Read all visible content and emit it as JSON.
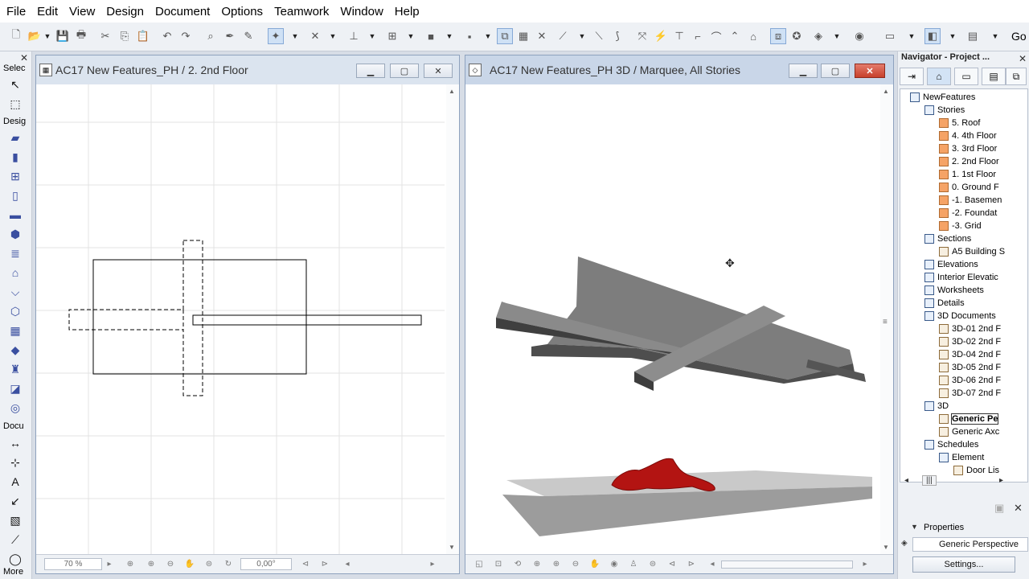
{
  "menu": [
    "File",
    "Edit",
    "View",
    "Design",
    "Document",
    "Options",
    "Teamwork",
    "Window",
    "Help"
  ],
  "toolbar": {
    "go_label": "Go"
  },
  "toolbox": {
    "select_label": "Selec",
    "design_label": "Desig",
    "document_label": "Docu",
    "more_label": "More"
  },
  "plan_window": {
    "title": "AC17 New Features_PH / 2. 2nd Floor",
    "zoom": "70 %",
    "angle": "0,00°"
  },
  "view3d_window": {
    "title": "AC17 New Features_PH 3D / Marquee, All Stories"
  },
  "navigator": {
    "title": "Navigator - Project ...",
    "tree": [
      {
        "label": "NewFeatures",
        "level": 0,
        "kind": "folder"
      },
      {
        "label": "Stories",
        "level": 1,
        "kind": "folder"
      },
      {
        "label": "5. Roof",
        "level": 2,
        "kind": "story"
      },
      {
        "label": "4. 4th Floor",
        "level": 2,
        "kind": "story"
      },
      {
        "label": "3. 3rd Floor",
        "level": 2,
        "kind": "story"
      },
      {
        "label": "2. 2nd Floor",
        "level": 2,
        "kind": "story"
      },
      {
        "label": "1. 1st Floor",
        "level": 2,
        "kind": "story"
      },
      {
        "label": "0. Ground F",
        "level": 2,
        "kind": "story"
      },
      {
        "label": "-1. Basemen",
        "level": 2,
        "kind": "story"
      },
      {
        "label": "-2. Foundat",
        "level": 2,
        "kind": "story"
      },
      {
        "label": "-3. Grid",
        "level": 2,
        "kind": "story"
      },
      {
        "label": "Sections",
        "level": 1,
        "kind": "folder"
      },
      {
        "label": "A5 Building S",
        "level": 2,
        "kind": "doc"
      },
      {
        "label": "Elevations",
        "level": 1,
        "kind": "folder"
      },
      {
        "label": "Interior Elevatic",
        "level": 1,
        "kind": "folder"
      },
      {
        "label": "Worksheets",
        "level": 1,
        "kind": "folder"
      },
      {
        "label": "Details",
        "level": 1,
        "kind": "folder"
      },
      {
        "label": "3D Documents",
        "level": 1,
        "kind": "folder"
      },
      {
        "label": "3D-01 2nd F",
        "level": 2,
        "kind": "doc"
      },
      {
        "label": "3D-02 2nd F",
        "level": 2,
        "kind": "doc"
      },
      {
        "label": "3D-04 2nd F",
        "level": 2,
        "kind": "doc"
      },
      {
        "label": "3D-05 2nd F",
        "level": 2,
        "kind": "doc"
      },
      {
        "label": "3D-06 2nd F",
        "level": 2,
        "kind": "doc"
      },
      {
        "label": "3D-07 2nd F",
        "level": 2,
        "kind": "doc"
      },
      {
        "label": "3D",
        "level": 1,
        "kind": "folder"
      },
      {
        "label": "Generic Pe",
        "level": 2,
        "kind": "doc",
        "selected": true
      },
      {
        "label": "Generic Axc",
        "level": 2,
        "kind": "doc"
      },
      {
        "label": "Schedules",
        "level": 1,
        "kind": "folder"
      },
      {
        "label": "Element",
        "level": 2,
        "kind": "folder"
      },
      {
        "label": "Door Lis",
        "level": 3,
        "kind": "doc"
      }
    ],
    "properties_title": "Properties",
    "properties_value": "Generic Perspective",
    "settings_label": "Settings..."
  }
}
